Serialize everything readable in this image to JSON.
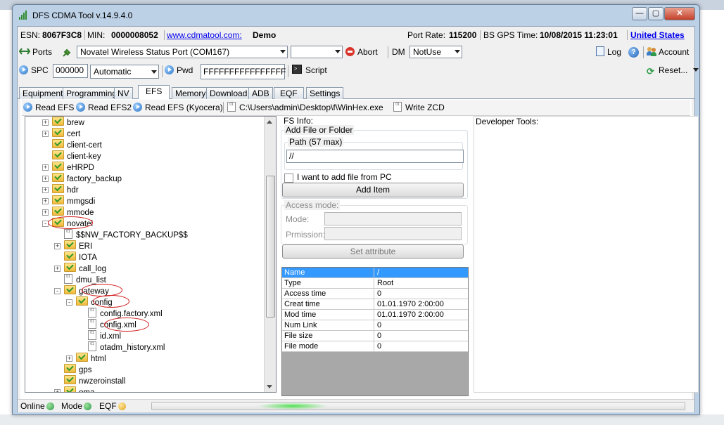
{
  "window": {
    "title": "DFS CDMA Tool v.14.9.4.0"
  },
  "info_bar": {
    "esn_label": "ESN:",
    "esn_value": "8067F3C8",
    "min_label": "MIN:",
    "min_value": "0000008052",
    "site_link": "www.cdmatool.com:",
    "edition": "Demo",
    "port_rate_label": "Port Rate:",
    "port_rate_value": "115200",
    "bs_gps_label": "BS GPS Time:",
    "bs_gps_value": "10/08/2015 11:23:01",
    "country_link": "United States"
  },
  "toolbar1": {
    "ports_label": "Ports",
    "port_select": "Novatel Wireless Status Port (COM167)",
    "second_select": "",
    "abort_label": "Abort",
    "dm_label": "DM",
    "dm_select": "NotUse",
    "log_label": "Log",
    "account_label": "Account"
  },
  "toolbar2": {
    "spc_label": "SPC",
    "spc_value": "000000",
    "mode_select": "Automatic",
    "pwd_label": "Pwd",
    "pwd_value": "FFFFFFFFFFFFFFFF",
    "script_label": "Script",
    "reset_label": "Reset..."
  },
  "tabs": [
    "Equipment",
    "Programming",
    "NV",
    "EFS",
    "Memory",
    "Download",
    "ADB",
    "EQF",
    "Settings"
  ],
  "active_tab": "EFS",
  "efs_toolbar": {
    "read_efs": "Read EFS",
    "read_efs2": "Read EFS2",
    "read_efs_kyocera": "Read EFS (Kyocera)",
    "path": "C:\\Users\\admin\\Desktop\\f\\WinHex.exe",
    "write_zcd": "Write ZCD"
  },
  "tree": [
    {
      "label": "brew",
      "type": "folder",
      "level": 0,
      "expander": "+"
    },
    {
      "label": "cert",
      "type": "folder",
      "level": 0,
      "expander": "+"
    },
    {
      "label": "client-cert",
      "type": "folder",
      "level": 0,
      "expander": ""
    },
    {
      "label": "client-key",
      "type": "folder",
      "level": 0,
      "expander": ""
    },
    {
      "label": "eHRPD",
      "type": "folder",
      "level": 0,
      "expander": "+"
    },
    {
      "label": "factory_backup",
      "type": "folder",
      "level": 0,
      "expander": "+"
    },
    {
      "label": "hdr",
      "type": "folder",
      "level": 0,
      "expander": "+"
    },
    {
      "label": "mmgsdi",
      "type": "folder",
      "level": 0,
      "expander": "+"
    },
    {
      "label": "mmode",
      "type": "folder",
      "level": 0,
      "expander": "+"
    },
    {
      "label": "novatel",
      "type": "folder",
      "level": 0,
      "expander": "-"
    },
    {
      "label": "$$NW_FACTORY_BACKUP$$",
      "type": "file",
      "level": 1,
      "expander": ""
    },
    {
      "label": "ERI",
      "type": "folder",
      "level": 1,
      "expander": "+"
    },
    {
      "label": "IOTA",
      "type": "folder",
      "level": 1,
      "expander": ""
    },
    {
      "label": "call_log",
      "type": "folder",
      "level": 1,
      "expander": "+"
    },
    {
      "label": "dmu_list",
      "type": "file",
      "level": 1,
      "expander": ""
    },
    {
      "label": "gateway",
      "type": "folder",
      "level": 1,
      "expander": "-"
    },
    {
      "label": "config",
      "type": "folder",
      "level": 2,
      "expander": "-"
    },
    {
      "label": "config.factory.xml",
      "type": "file",
      "level": 3,
      "expander": ""
    },
    {
      "label": "config.xml",
      "type": "file",
      "level": 3,
      "expander": ""
    },
    {
      "label": "id.xml",
      "type": "file",
      "level": 3,
      "expander": ""
    },
    {
      "label": "otadm_history.xml",
      "type": "file",
      "level": 3,
      "expander": ""
    },
    {
      "label": "html",
      "type": "folder",
      "level": 2,
      "expander": "+"
    },
    {
      "label": "gps",
      "type": "folder",
      "level": 1,
      "expander": ""
    },
    {
      "label": "nwzeroinstall",
      "type": "folder",
      "level": 1,
      "expander": ""
    },
    {
      "label": "oma",
      "type": "folder",
      "level": 1,
      "expander": "+"
    }
  ],
  "fs_info": {
    "heading": "FS Info:",
    "add_group": "Add File or Folder",
    "path_group": "Path (57 max)",
    "path_value": "//",
    "add_from_pc": "I want to add file from PC",
    "add_item": "Add Item",
    "access_group": "Access mode:",
    "mode_label": "Mode:",
    "permission_label": "Prmission:",
    "set_attribute": "Set attribute"
  },
  "properties": [
    {
      "name": "Name",
      "value": "/"
    },
    {
      "name": "Type",
      "value": "Root"
    },
    {
      "name": "Access time",
      "value": "0"
    },
    {
      "name": "Creat time",
      "value": "01.01.1970 2:00:00"
    },
    {
      "name": "Mod time",
      "value": "01.01.1970 2:00:00"
    },
    {
      "name": "Num Link",
      "value": "0"
    },
    {
      "name": "File size",
      "value": "0"
    },
    {
      "name": "File mode",
      "value": "0"
    }
  ],
  "developer_tools": {
    "heading": "Developer Tools:"
  },
  "status_bar": {
    "online": "Online",
    "mode": "Mode",
    "eqf": "EQF"
  },
  "colors": {
    "accent": "#3399ff",
    "link": "#0000ee",
    "annotation": "#d21b1b"
  }
}
